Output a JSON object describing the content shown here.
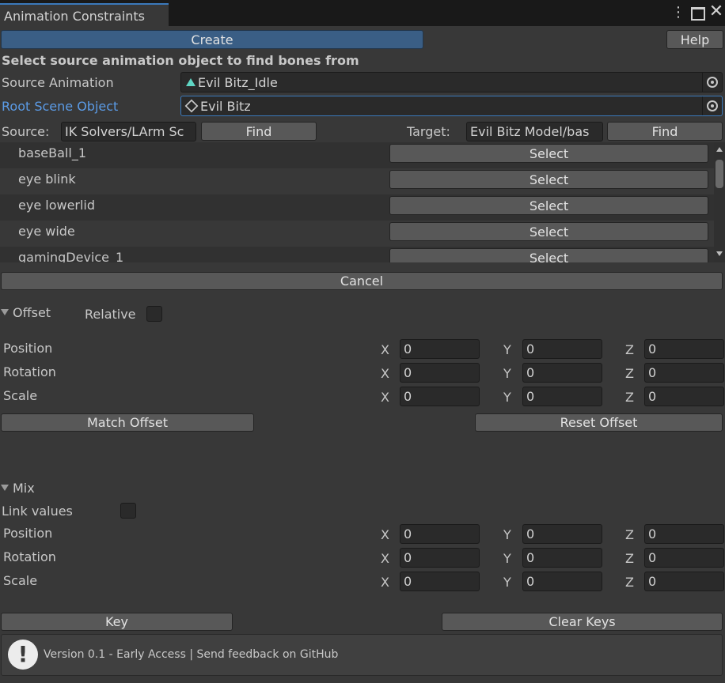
{
  "window": {
    "tab_title": "Animation Constraints"
  },
  "toolbar": {
    "create_label": "Create",
    "help_label": "Help"
  },
  "instruction": "Select source animation object to find bones from",
  "source_animation": {
    "label": "Source Animation",
    "value": "Evil Bitz_Idle"
  },
  "root_scene_object": {
    "label": "Root Scene Object",
    "value": "Evil Bitz"
  },
  "find": {
    "source_label": "Source:",
    "source_value": "IK Solvers/LArm Sc",
    "target_label": "Target:",
    "target_value": "Evil Bitz Model/bas",
    "find_label": "Find"
  },
  "bones": [
    {
      "name": "baseBall_1",
      "button": "Select"
    },
    {
      "name": "eye blink",
      "button": "Select"
    },
    {
      "name": "eye lowerlid",
      "button": "Select"
    },
    {
      "name": "eye wide",
      "button": "Select"
    },
    {
      "name": "gamingDevice_1",
      "button": "Select"
    }
  ],
  "cancel_label": "Cancel",
  "offset": {
    "title": "Offset",
    "relative_label": "Relative",
    "rows": [
      {
        "label": "Position",
        "x": "0",
        "y": "0",
        "z": "0"
      },
      {
        "label": "Rotation",
        "x": "0",
        "y": "0",
        "z": "0"
      },
      {
        "label": "Scale",
        "x": "0",
        "y": "0",
        "z": "0"
      }
    ],
    "match_label": "Match Offset",
    "reset_label": "Reset Offset"
  },
  "mix": {
    "title": "Mix",
    "link_label": "Link values",
    "rows": [
      {
        "label": "Position",
        "x": "0",
        "y": "0",
        "z": "0"
      },
      {
        "label": "Rotation",
        "x": "0",
        "y": "0",
        "z": "0"
      },
      {
        "label": "Scale",
        "x": "0",
        "y": "0",
        "z": "0"
      }
    ]
  },
  "axes": {
    "x": "X",
    "y": "Y",
    "z": "Z"
  },
  "keys": {
    "key_label": "Key",
    "clear_label": "Clear Keys"
  },
  "footer": {
    "text": "Version 0.1 - Early Access | Send feedback on GitHub"
  },
  "colors": {
    "background": "#383838",
    "accent": "#3a5e85",
    "focus": "#3a79bb",
    "link_label": "#5b9be6"
  }
}
